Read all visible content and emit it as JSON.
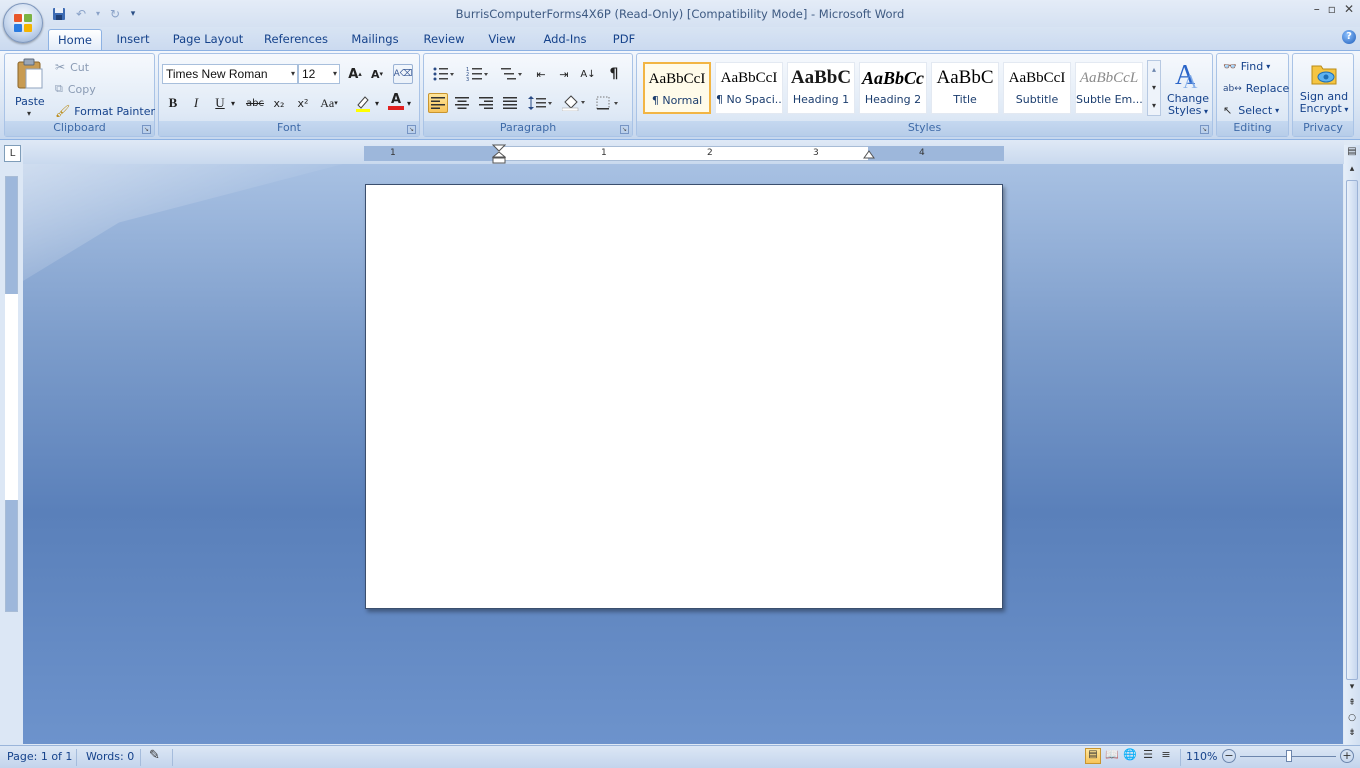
{
  "window": {
    "title": "BurrisComputerForms4X6P (Read-Only) [Compatibility Mode] - Microsoft Word",
    "controls": [
      "–",
      "▫",
      "✕"
    ]
  },
  "qat": {
    "save_icon": "save-icon",
    "undo_icon": "undo-icon",
    "redo_icon": "redo-icon",
    "more": "▾"
  },
  "tabs": [
    "Home",
    "Insert",
    "Page Layout",
    "References",
    "Mailings",
    "Review",
    "View",
    "Add-Ins",
    "PDF"
  ],
  "help": "?",
  "clipboard": {
    "label": "Clipboard",
    "paste": "Paste",
    "cut": "Cut",
    "copy": "Copy",
    "format_painter": "Format Painter"
  },
  "font": {
    "label": "Font",
    "family": "Times New Roman",
    "size": "12",
    "grow": "A",
    "shrink": "A",
    "bold": "B",
    "italic": "I",
    "underline": "U",
    "strike": "abc",
    "subscript": "x₂",
    "superscript": "x²",
    "case": "Aa",
    "font_color": "A"
  },
  "paragraph": {
    "label": "Paragraph",
    "pilcrow": "¶"
  },
  "styles": {
    "label": "Styles",
    "items": [
      {
        "sample": "AaBbCcI",
        "name": "¶ Normal"
      },
      {
        "sample": "AaBbCcI",
        "name": "¶ No Spaci..."
      },
      {
        "sample": "AaBbC",
        "name": "Heading 1"
      },
      {
        "sample": "AaBbCc",
        "name": "Heading 2"
      },
      {
        "sample": "AaBbC",
        "name": "Title"
      },
      {
        "sample": "AaBbCcI",
        "name": "Subtitle"
      },
      {
        "sample": "AaBbCcL",
        "name": "Subtle Em..."
      }
    ],
    "change_styles_line1": "Change",
    "change_styles_line2": "Styles"
  },
  "editing": {
    "label": "Editing",
    "find": "Find",
    "replace": "Replace",
    "select": "Select"
  },
  "privacy": {
    "label": "Privacy",
    "sign_line1": "Sign and",
    "sign_line2": "Encrypt"
  },
  "ruler": {
    "corner": "L",
    "numbers": [
      "1",
      "1",
      "2",
      "3",
      "4"
    ]
  },
  "status": {
    "page": "Page: 1 of 1",
    "words": "Words: 0",
    "zoom": "110%",
    "zoom_out": "−",
    "zoom_in": "+"
  }
}
